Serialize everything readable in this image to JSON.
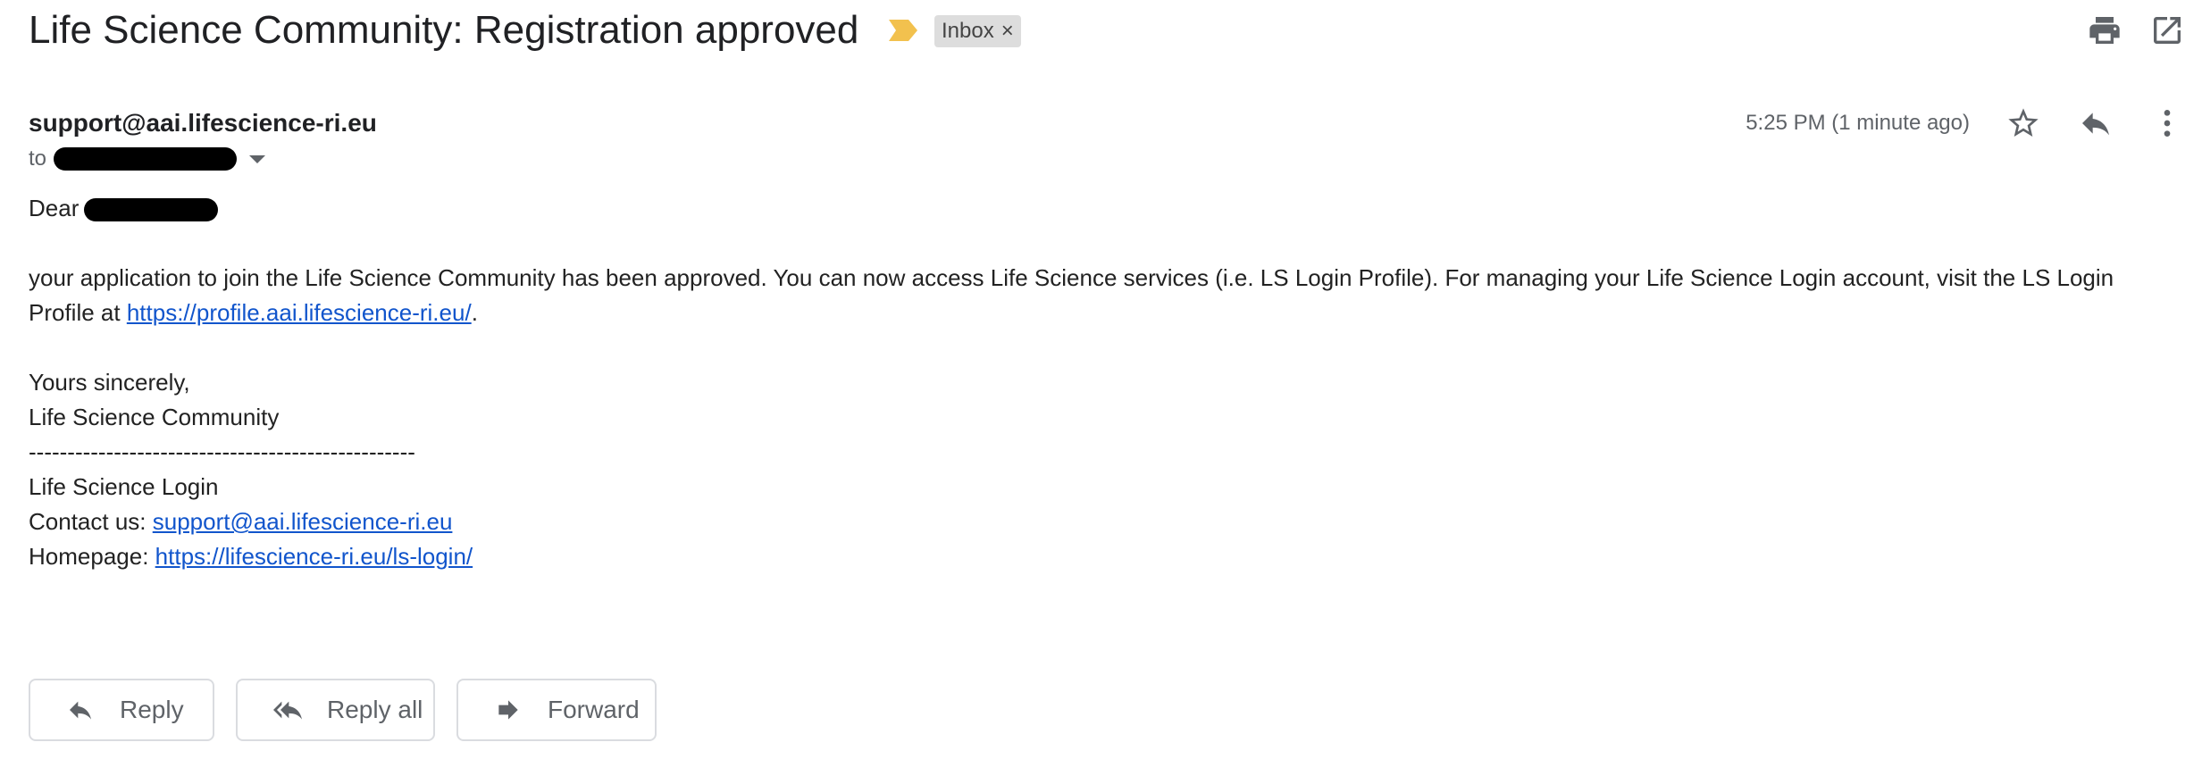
{
  "header": {
    "subject": "Life Science Community: Registration approved",
    "label": "Inbox",
    "label_close": "×",
    "importance_color": "#f2c14e",
    "icons": [
      "importance-marker-icon",
      "print-icon",
      "open-in-new-window-icon"
    ]
  },
  "message": {
    "sender": "support@aai.lifescience-ri.eu",
    "to_prefix": "to",
    "timestamp": "5:25 PM (1 minute ago)",
    "icons": [
      "star-icon",
      "reply-icon",
      "more-vert-icon"
    ]
  },
  "body": {
    "greeting": "Dear",
    "paragraph": "your application to join the Life Science Community has been approved. You can now access Life Science services (i.e. LS Login Profile). For managing your Life Science Login account, visit the LS Login Profile at ",
    "profile_link": "https://profile.aai.lifescience-ri.eu/",
    "paragraph_end": ".",
    "closing": "Yours sincerely,",
    "signature": "Life Science Community",
    "divider": "--------------------------------------------------",
    "footer_title": "Life Science Login",
    "contact_label": "Contact us: ",
    "contact_link": "support@aai.lifescience-ri.eu",
    "homepage_label": "Homepage: ",
    "homepage_link": "https://lifescience-ri.eu/ls-login/"
  },
  "actions": {
    "reply": "Reply",
    "reply_all": "Reply all",
    "forward": "Forward"
  },
  "colors": {
    "link": "#1155cc",
    "chip_bg": "#dddddd",
    "muted": "#5f6368"
  }
}
